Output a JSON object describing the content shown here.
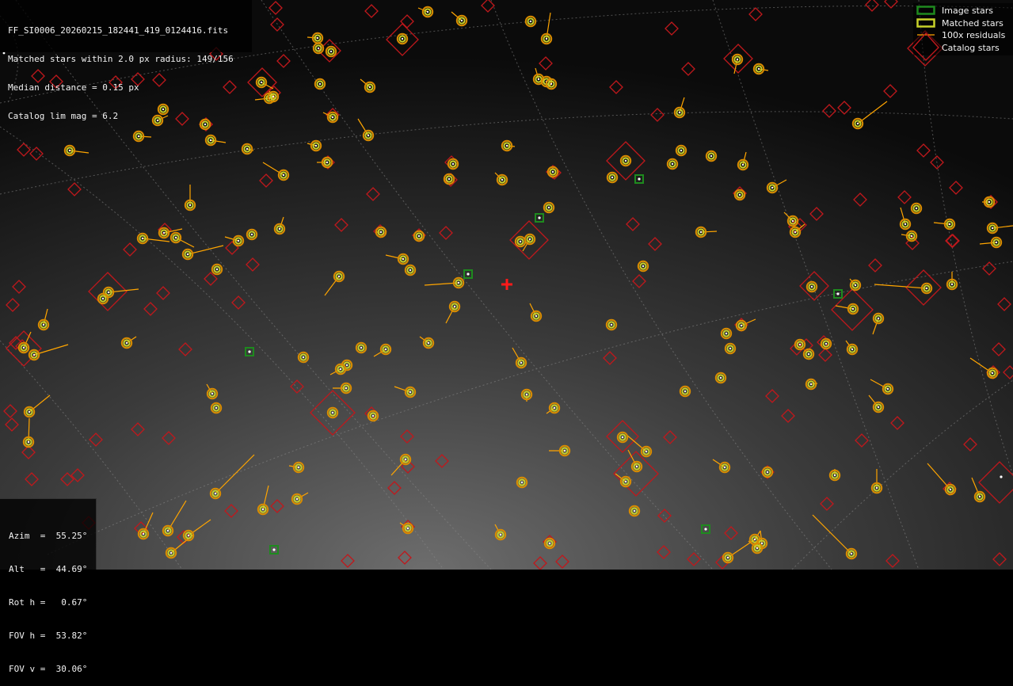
{
  "info": {
    "filename": "FF_SI0006_20260215_182441_419_0124416.fits",
    "matched": "Matched stars within 2.0 px radius: 149/156",
    "median": "Median distance = 0.15 px",
    "catalog": "Catalog lim mag = 6.2"
  },
  "legend": {
    "image_stars": "Image stars",
    "matched_stars": "Matched stars",
    "residuals": "100x residuals",
    "catalog_stars": "Catalog stars"
  },
  "params": {
    "azim": "Azim  =  55.25°",
    "alt": "Alt   =  44.69°",
    "roth": "Rot h =   0.67°",
    "fovh": "FOV h =  53.82°",
    "fovv": "FOV v =  30.06°"
  },
  "colors": {
    "image_star": "#1e8a1e",
    "matched_outer": "#d98c00",
    "matched_inner": "#c8d22a",
    "residual": "#ffa500",
    "catalog": "#c0181c",
    "center": "#ff1a1a"
  }
}
